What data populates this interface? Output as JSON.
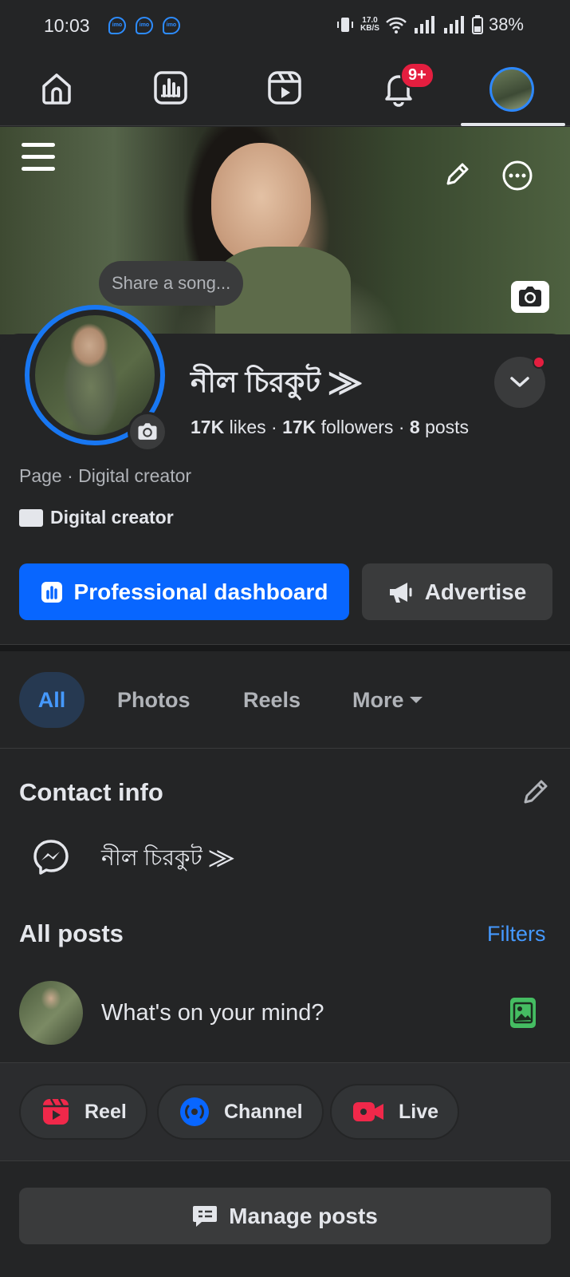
{
  "status_bar": {
    "time": "10:03",
    "net_speed_value": "17.0",
    "net_speed_unit": "KB/S",
    "battery": "38%"
  },
  "tabs": {
    "notifications_badge": "9+",
    "active_tab": "profile"
  },
  "cover": {
    "share_song_placeholder": "Share a song..."
  },
  "profile": {
    "name": "নীল চিরকুট ⨠",
    "likes_count": "17K",
    "likes_label": "likes",
    "followers_count": "17K",
    "followers_label": "followers",
    "posts_count": "8",
    "posts_label": "posts",
    "stat_separator": "·",
    "page_type": "Page · Digital creator",
    "category": "Digital creator",
    "primary_button": "Professional dashboard",
    "secondary_button": "Advertise"
  },
  "filter_tabs": [
    "All",
    "Photos",
    "Reels",
    "More"
  ],
  "contact": {
    "title": "Contact info",
    "messenger_name": "নীল চিরকুট ⨠"
  },
  "posts": {
    "title": "All posts",
    "filters_link": "Filters",
    "composer_placeholder": "What's on your mind?",
    "actions": [
      "Reel",
      "Channel",
      "Live"
    ],
    "manage_button": "Manage posts"
  },
  "colors": {
    "background": "#242526",
    "accent": "#0866ff",
    "link": "#4599ff",
    "notification_red": "#e41e3f",
    "photo_green": "#45bd62"
  }
}
